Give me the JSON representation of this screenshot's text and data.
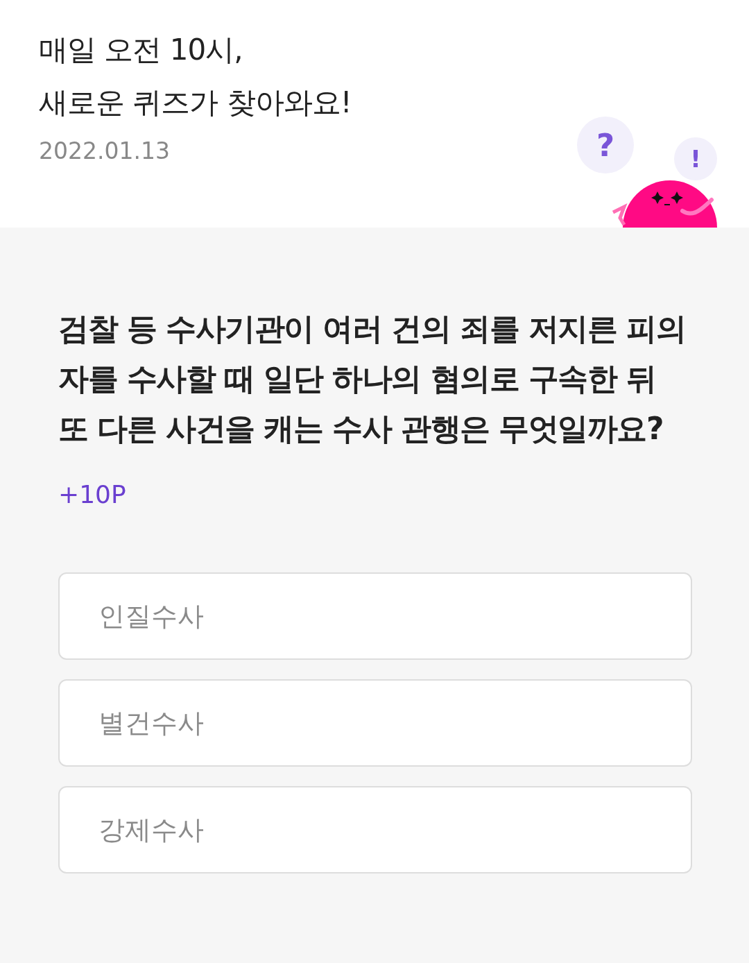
{
  "header": {
    "title_lines": [
      "매일 오전 10시,",
      "새로운 퀴즈가 찾아와요!"
    ],
    "date": "2022.01.13",
    "bubbles": [
      "?",
      "!"
    ]
  },
  "quiz": {
    "question": "검찰 등 수사기관이 여러 건의 죄를 저지른 피의자를 수사할 때 일단 하나의 혐의로 구속한 뒤 또 다른 사건을 캐는 수사 관행은 무엇일까요?",
    "points": "+10P",
    "options": [
      {
        "label": "인질수사",
        "selected": false
      },
      {
        "label": "별건수사",
        "selected": false
      },
      {
        "label": "강제수사",
        "selected": false
      }
    ]
  }
}
